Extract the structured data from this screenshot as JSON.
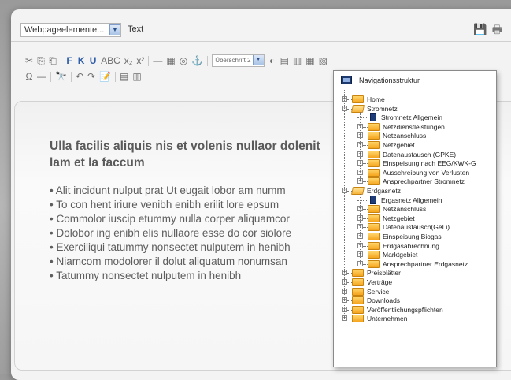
{
  "toolbar": {
    "format_select": "Webpageelemente...",
    "style_select": "Text",
    "heading_select": "Überschrift 2",
    "row1_buttons": [
      "✂",
      "⎘",
      "⎗",
      "|",
      "F",
      "K",
      "U",
      "ABC",
      "x₂",
      "x²",
      "|",
      "—",
      "▦",
      "◎",
      "⚓",
      "|"
    ],
    "row2_buttons": [
      "Ω",
      "—",
      "|",
      "🔭",
      "|",
      "↶",
      "↷",
      "📝",
      "|",
      "▤",
      "▥",
      "|"
    ]
  },
  "document": {
    "heading": "Ulla facilis aliquis nis et volenis nullaor dolenit lam et la faccum",
    "bullets": [
      "Alit incidunt nulput prat Ut eugait lobor am numm",
      "To con hent iriure venibh enibh erilit lore epsum",
      "Commolor iuscip etummy nulla corper aliquamcor",
      "Dolobor ing enibh elis nullaore esse do cor siolore",
      "Exerciliqui tatummy nonsectet nulputem in henibh",
      "Niamcom modolorer il dolut aliquatum nonumsan",
      "Tatummy nonsectet nulputem in henibh"
    ]
  },
  "nav_popup": {
    "title": "Navigationsstruktur",
    "items": [
      {
        "label": "Home",
        "level": 0,
        "type": "folder",
        "expander": "+"
      },
      {
        "label": "Stromnetz",
        "level": 0,
        "type": "folder-open",
        "expander": "-"
      },
      {
        "label": "Stromnetz Allgemein",
        "level": 1,
        "type": "page",
        "expander": ""
      },
      {
        "label": "Netzdienstleistungen",
        "level": 1,
        "type": "folder",
        "expander": "+"
      },
      {
        "label": "Netzanschluss",
        "level": 1,
        "type": "folder",
        "expander": "+"
      },
      {
        "label": "Netzgebiet",
        "level": 1,
        "type": "folder",
        "expander": "+"
      },
      {
        "label": "Datenaustausch (GPKE)",
        "level": 1,
        "type": "folder",
        "expander": "+"
      },
      {
        "label": "Einspeisung nach EEG/KWK-G",
        "level": 1,
        "type": "folder",
        "expander": "+"
      },
      {
        "label": "Ausschreibung von Verlusten",
        "level": 1,
        "type": "folder",
        "expander": "+"
      },
      {
        "label": "Ansprechpartner Stromnetz",
        "level": 1,
        "type": "folder",
        "expander": "+"
      },
      {
        "label": "Erdgasnetz",
        "level": 0,
        "type": "folder-open",
        "expander": "-"
      },
      {
        "label": "Ergasnetz Allgemein",
        "level": 1,
        "type": "page",
        "expander": ""
      },
      {
        "label": "Netzanschluss",
        "level": 1,
        "type": "folder",
        "expander": "+"
      },
      {
        "label": "Netzgebiet",
        "level": 1,
        "type": "folder",
        "expander": "+"
      },
      {
        "label": "Datenaustausch(GeLi)",
        "level": 1,
        "type": "folder",
        "expander": "+"
      },
      {
        "label": "Einspeisung Biogas",
        "level": 1,
        "type": "folder",
        "expander": "+"
      },
      {
        "label": "Erdgasabrechnung",
        "level": 1,
        "type": "folder",
        "expander": "+"
      },
      {
        "label": "Marktgebiet",
        "level": 1,
        "type": "folder",
        "expander": "+"
      },
      {
        "label": "Ansprechpartner Erdgasnetz",
        "level": 1,
        "type": "folder",
        "expander": "+"
      },
      {
        "label": "Preisblätter",
        "level": 0,
        "type": "folder",
        "expander": "+"
      },
      {
        "label": "Verträge",
        "level": 0,
        "type": "folder",
        "expander": "+"
      },
      {
        "label": "Service",
        "level": 0,
        "type": "folder",
        "expander": "+"
      },
      {
        "label": "Downloads",
        "level": 0,
        "type": "folder",
        "expander": "+"
      },
      {
        "label": "Veröffentlichungspflichten",
        "level": 0,
        "type": "folder",
        "expander": "+"
      },
      {
        "label": "Unternehmen",
        "level": 0,
        "type": "folder",
        "expander": "+"
      }
    ]
  }
}
